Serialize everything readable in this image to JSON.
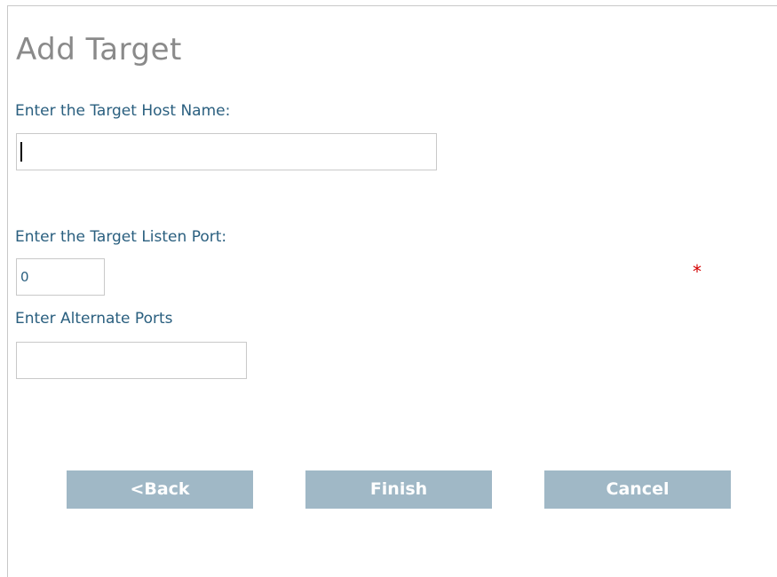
{
  "page": {
    "title": "Add Target"
  },
  "form": {
    "host_label": "Enter the Target Host Name:",
    "host_value": "",
    "port_label": "Enter the Target Listen Port:",
    "port_value": "0",
    "required_marker": "*",
    "alt_ports_label": "Enter Alternate Ports",
    "alt_ports_value": ""
  },
  "buttons": {
    "back_label": "<Back",
    "finish_label": "Finish",
    "cancel_label": "Cancel"
  },
  "colors": {
    "title": "#8a8a8a",
    "label": "#2a5f7f",
    "required": "#d40000",
    "button_bg": "#a0b8c6",
    "button_text": "#ffffff",
    "input_border": "#c9c9c9"
  }
}
